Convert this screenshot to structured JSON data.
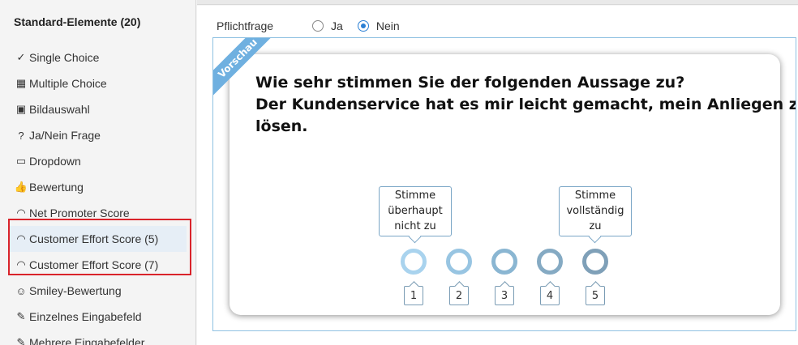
{
  "sidebar": {
    "title": "Standard-Elemente (20)",
    "items": [
      {
        "label": "Single Choice",
        "icon": "check-circle-icon",
        "glyph": "✓"
      },
      {
        "label": "Multiple Choice",
        "icon": "grid-icon",
        "glyph": "▦"
      },
      {
        "label": "Bildauswahl",
        "icon": "image-icon",
        "glyph": "▣"
      },
      {
        "label": "Ja/Nein Frage",
        "icon": "question-icon",
        "glyph": "?"
      },
      {
        "label": "Dropdown",
        "icon": "dropdown-icon",
        "glyph": "▭"
      },
      {
        "label": "Bewertung",
        "icon": "thumbs-up-icon",
        "glyph": "👍"
      },
      {
        "label": "Net Promoter Score",
        "icon": "gauge-icon",
        "glyph": "◠"
      },
      {
        "label": "Customer Effort Score (5)",
        "icon": "gauge-icon",
        "glyph": "◠"
      },
      {
        "label": "Customer Effort Score (7)",
        "icon": "gauge-icon",
        "glyph": "◠"
      },
      {
        "label": "Smiley-Bewertung",
        "icon": "smiley-icon",
        "glyph": "☺"
      },
      {
        "label": "Einzelnes Eingabefeld",
        "icon": "edit-icon",
        "glyph": "✎"
      },
      {
        "label": "Mehrere Eingabefelder",
        "icon": "edit-icon",
        "glyph": "✎"
      }
    ]
  },
  "pflichtfrage": {
    "label": "Pflichtfrage",
    "options": [
      "Ja",
      "Nein"
    ],
    "selected": "Nein"
  },
  "preview": {
    "ribbon": "Vorschau",
    "question_lines": [
      "Wie sehr stimmen Sie der folgenden Aussage zu?",
      "Der Kundenservice hat es mir leicht gemacht, mein Anliegen zu",
      "lösen."
    ],
    "left_tooltip": [
      "Stimme",
      "überhaupt",
      "nicht zu"
    ],
    "right_tooltip": [
      "Stimme",
      "vollständig",
      "zu"
    ],
    "scale": [
      "1",
      "2",
      "3",
      "4",
      "5"
    ],
    "scale_colors": [
      "#a9d3ee",
      "#98c5e2",
      "#8ab6d2",
      "#85aac3",
      "#7fa0b8"
    ]
  }
}
